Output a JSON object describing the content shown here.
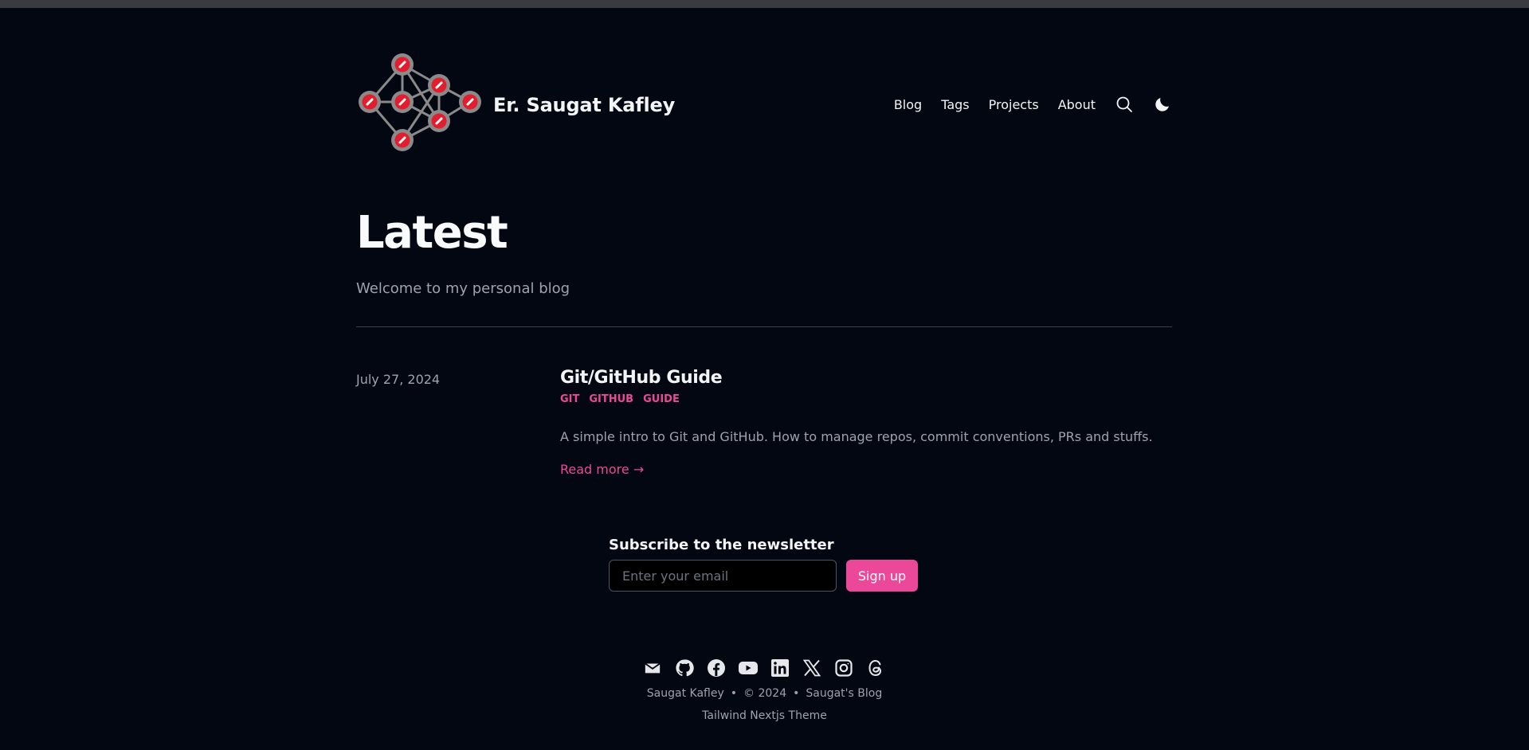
{
  "site": {
    "title": "Er. Saugat Kafley"
  },
  "nav": {
    "items": [
      {
        "label": "Blog"
      },
      {
        "label": "Tags"
      },
      {
        "label": "Projects"
      },
      {
        "label": "About"
      }
    ],
    "search_icon": "search-icon",
    "theme_icon": "moon-icon"
  },
  "hero": {
    "title": "Latest",
    "description": "Welcome to my personal blog"
  },
  "posts": [
    {
      "date": "July 27, 2024",
      "title": "Git/GitHub Guide",
      "tags": [
        "GIT",
        "GITHUB",
        "GUIDE"
      ],
      "summary": "A simple intro to Git and GitHub. How to manage repos, commit conventions, PRs and stuffs.",
      "read_more": "Read more →"
    }
  ],
  "newsletter": {
    "title": "Subscribe to the newsletter",
    "placeholder": "Enter your email",
    "button": "Sign up"
  },
  "footer": {
    "social_icons": [
      "mail-icon",
      "github-icon",
      "facebook-icon",
      "youtube-icon",
      "linkedin-icon",
      "x-icon",
      "instagram-icon",
      "threads-icon"
    ],
    "author": "Saugat Kafley",
    "separator": "•",
    "copyright": "© 2024",
    "blog_name": "Saugat's Blog",
    "theme": "Tailwind Nextjs Theme"
  },
  "colors": {
    "background": "#030712",
    "accent": "#ec4899",
    "logo_node": "#e11d2e",
    "logo_ring": "#9ca3af"
  }
}
